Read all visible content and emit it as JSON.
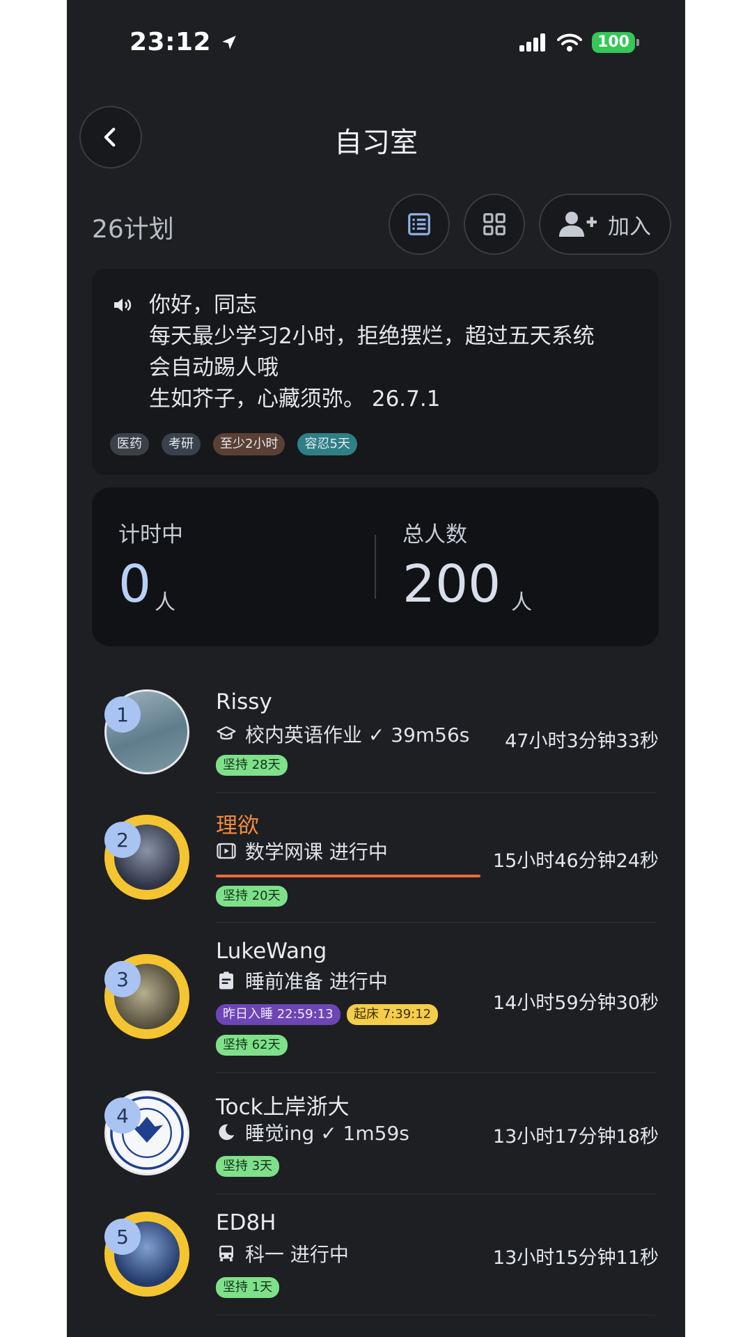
{
  "status_bar": {
    "time": "23:12",
    "battery": "100"
  },
  "header": {
    "title": "自习室"
  },
  "toolbar": {
    "plan_count": "26计划",
    "join_label": "加入"
  },
  "notice": {
    "lines": [
      "你好，同志",
      "每天最少学习2小时，拒绝摆烂，超过五天系统",
      "会自动踢人哦",
      "生如芥子，心藏须弥。 26.7.1"
    ],
    "tags": [
      "医药",
      "考研",
      "至少2小时",
      "容忍5天"
    ]
  },
  "stats": {
    "timing_label": "计时中",
    "timing_value": "0",
    "timing_unit": "人",
    "total_label": "总人数",
    "total_value": "200",
    "total_unit": "人"
  },
  "members": [
    {
      "rank": "1",
      "name": "Rissy",
      "task": "校内英语作业 ✓ 39m56s",
      "total": "47小时3分钟33秒",
      "streak": "坚持 28天"
    },
    {
      "rank": "2",
      "name": "理欲",
      "task": "数学网课 进行中",
      "total": "15小时46分钟24秒",
      "streak": "坚持 20天"
    },
    {
      "rank": "3",
      "name": "LukeWang",
      "task": "睡前准备 进行中",
      "total": "14小时59分钟30秒",
      "sleep": "昨日入睡 22:59:13",
      "wake": "起床 7:39:12",
      "streak": "坚持 62天"
    },
    {
      "rank": "4",
      "name": "Tock上岸浙大",
      "task": "睡觉ing ✓ 1m59s",
      "total": "13小时17分钟18秒",
      "streak": "坚持 3天"
    },
    {
      "rank": "5",
      "name": "ED8H",
      "task": "科一 进行中",
      "total": "13小时15分钟11秒",
      "streak": "坚持 1天"
    }
  ],
  "icons": [
    "back-icon",
    "location-arrow-icon",
    "signal-icon",
    "wifi-icon",
    "list-view-icon",
    "grid-view-icon",
    "add-user-icon",
    "speaker-icon",
    "graduation-cap-icon",
    "video-icon",
    "clipboard-icon",
    "moon-icon",
    "car-icon"
  ]
}
